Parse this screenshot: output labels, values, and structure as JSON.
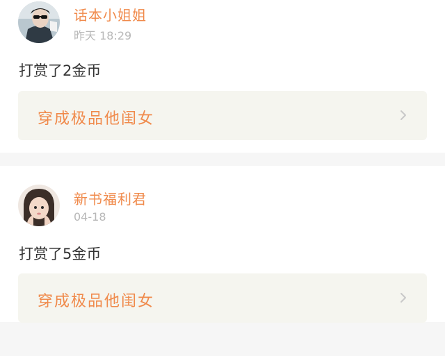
{
  "items": [
    {
      "user_name": "话本小姐姐",
      "time": "昨天 18:29",
      "reward_text": "打赏了2金币",
      "book_title": "穿成极品他闺女",
      "avatar_icon": "avatar-sunglasses",
      "chevron_icon": "chevron-right-icon"
    },
    {
      "user_name": "新书福利君",
      "time": "04-18",
      "reward_text": "打赏了5金币",
      "book_title": "穿成极品他闺女",
      "avatar_icon": "avatar-girl",
      "chevron_icon": "chevron-right-icon"
    }
  ],
  "colors": {
    "accent": "#f08a4b",
    "time": "#b8b8b8",
    "text": "#333333",
    "book_bg": "#f5f5ef",
    "page_bg": "#f6f6f6"
  }
}
